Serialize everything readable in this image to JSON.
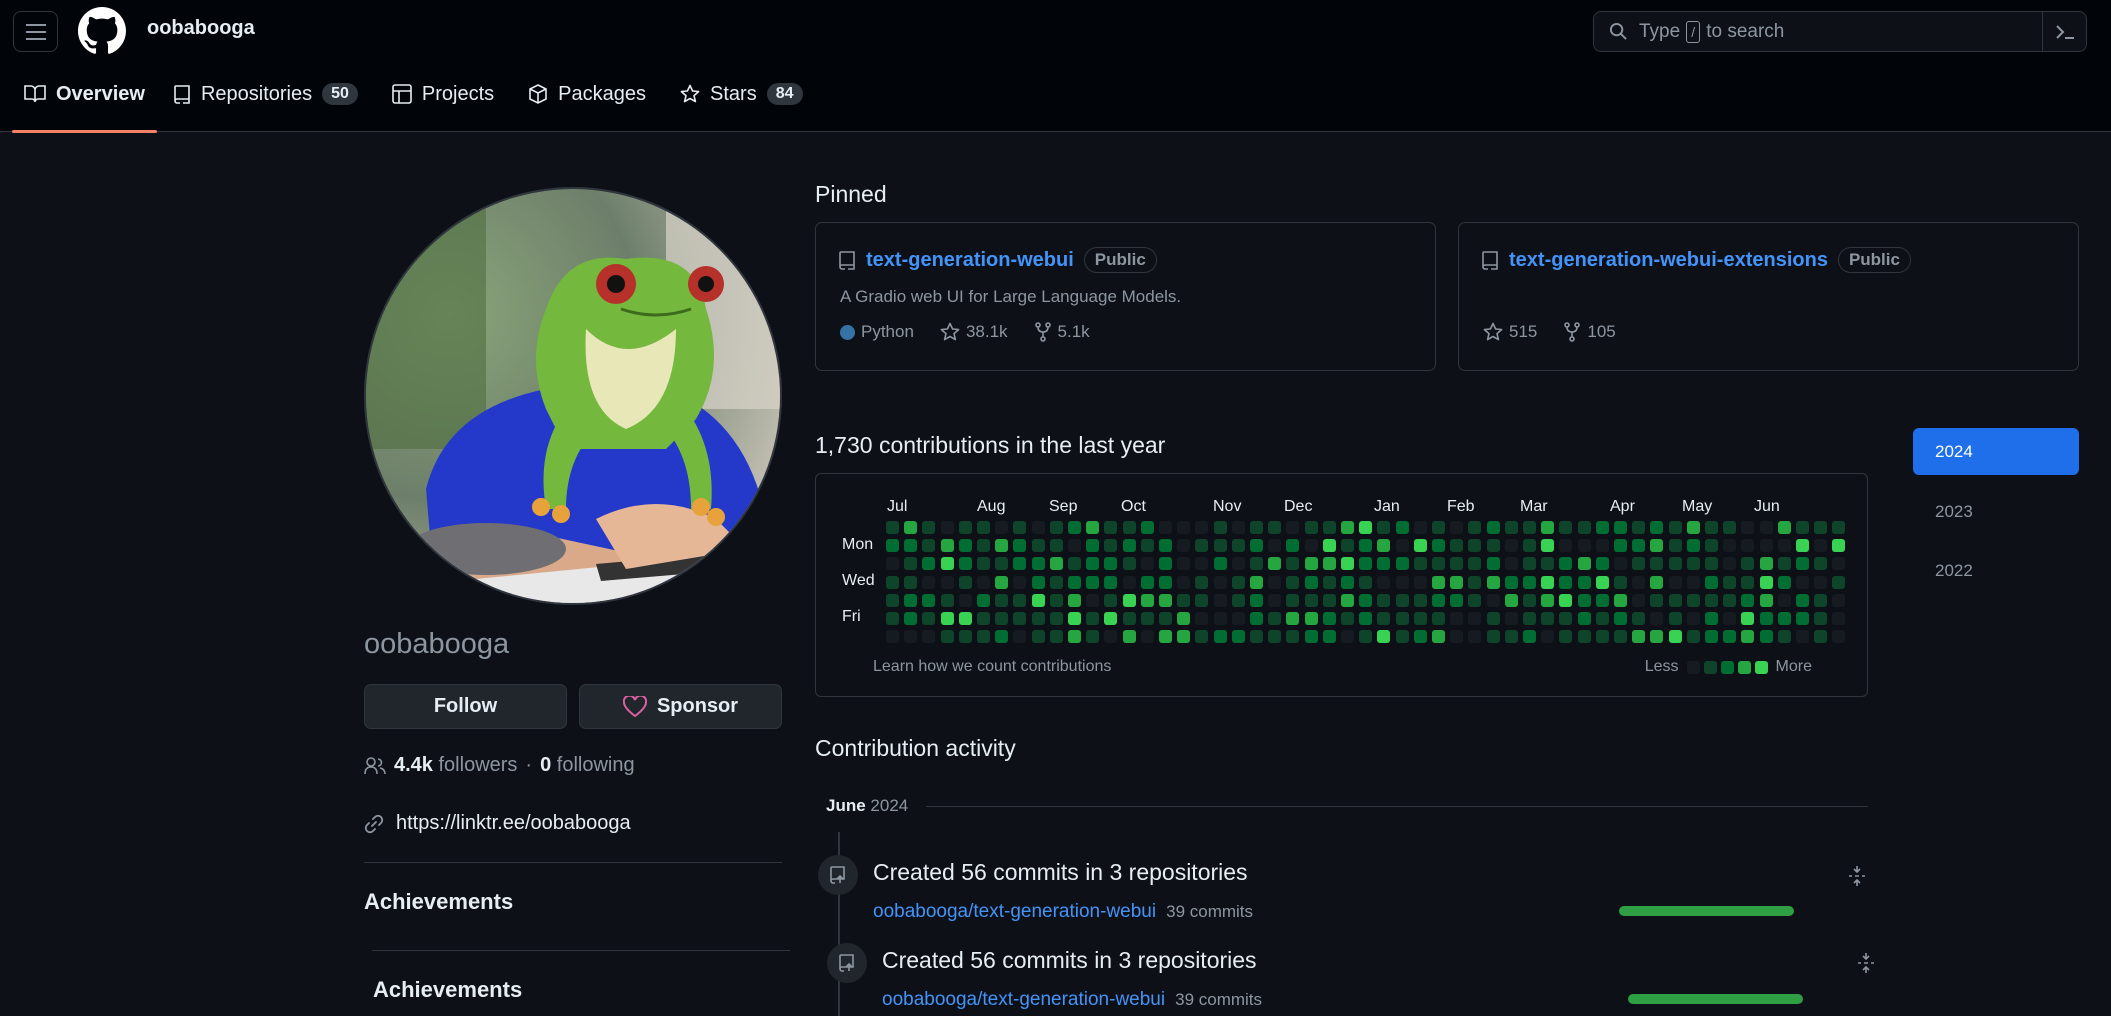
{
  "header": {
    "owner": "oobabooga",
    "search_type": "Type",
    "search_key": "/",
    "search_rest": "to search"
  },
  "tabs": [
    {
      "label": "Overview",
      "count": null
    },
    {
      "label": "Repositories",
      "count": "50"
    },
    {
      "label": "Projects",
      "count": null
    },
    {
      "label": "Packages",
      "count": null
    },
    {
      "label": "Stars",
      "count": "84"
    }
  ],
  "profile": {
    "username": "oobabooga",
    "follow_label": "Follow",
    "sponsor_label": "Sponsor",
    "followers_count": "4.4k",
    "followers_label": "followers",
    "following_count": "0",
    "following_label": "following",
    "separator": "·",
    "link": "https://linktr.ee/oobabooga",
    "achievements_1": "Achievements",
    "achievements_2": "Achievements"
  },
  "pinned": {
    "heading": "Pinned",
    "repos": [
      {
        "name": "text-generation-webui",
        "visibility": "Public",
        "description": "A Gradio web UI for Large Language Models.",
        "language": "Python",
        "language_color": "#3572A5",
        "stars": "38.1k",
        "forks": "5.1k"
      },
      {
        "name": "text-generation-webui-extensions",
        "visibility": "Public",
        "description": "",
        "stars": "515",
        "forks": "105"
      }
    ]
  },
  "contributions": {
    "heading": "1,730 contributions in the last year",
    "months": [
      "Jul",
      "Aug",
      "Sep",
      "Oct",
      "Nov",
      "Dec",
      "Jan",
      "Feb",
      "Mar",
      "Apr",
      "May",
      "Jun"
    ],
    "day_labels": [
      "Mon",
      "Wed",
      "Fri"
    ],
    "learn_link": "Learn how we count contributions",
    "legend_less": "Less",
    "legend_more": "More",
    "level_colors": [
      "#161b22",
      "#0e4429",
      "#006d32",
      "#26a641",
      "#39d353"
    ],
    "years": [
      "2024",
      "2023",
      "2022"
    ],
    "active_year": "2024"
  },
  "activity": {
    "heading": "Contribution activity",
    "period_month": "June",
    "period_year": "2024",
    "items": [
      {
        "title": "Created 56 commits in 3 repositories",
        "repo": "oobabooga/text-generation-webui",
        "commits": "39 commits",
        "share": 1.0
      },
      {
        "title": "Created 56 commits in 3 repositories",
        "repo": "oobabooga/text-generation-webui",
        "commits": "39 commits",
        "share": 1.0
      }
    ]
  }
}
